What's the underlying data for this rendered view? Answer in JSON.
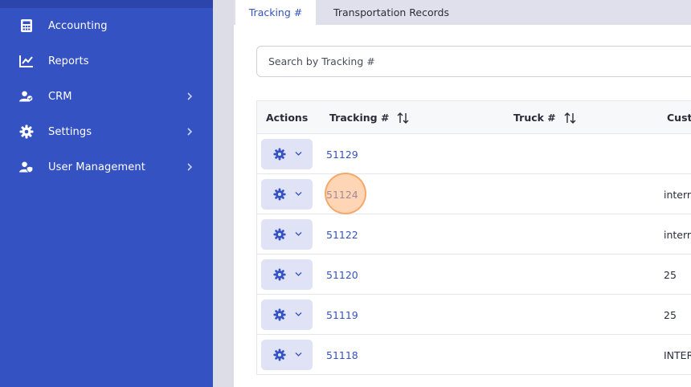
{
  "sidebar": {
    "items": [
      {
        "label": "Accounting",
        "icon": "calculator-icon",
        "has_children": false
      },
      {
        "label": "Reports",
        "icon": "line-chart-icon",
        "has_children": false
      },
      {
        "label": "CRM",
        "icon": "user-group-icon",
        "has_children": true
      },
      {
        "label": "Settings",
        "icon": "gear-icon",
        "has_children": true
      },
      {
        "label": "User Management",
        "icon": "user-shield-icon",
        "has_children": true
      }
    ]
  },
  "tabs": [
    {
      "label": "Tracking #",
      "active": true
    },
    {
      "label": "Transportation Records",
      "active": false
    }
  ],
  "search": {
    "placeholder": "Search by Tracking #",
    "value": ""
  },
  "table": {
    "columns": [
      "Actions",
      "Tracking #",
      "Truck #",
      "Custo"
    ],
    "rows": [
      {
        "tracking": "51129",
        "truck": "",
        "customer": ""
      },
      {
        "tracking": "51124",
        "truck": "",
        "customer": "interr"
      },
      {
        "tracking": "51122",
        "truck": "",
        "customer": "interr"
      },
      {
        "tracking": "51120",
        "truck": "",
        "customer": "25"
      },
      {
        "tracking": "51119",
        "truck": "",
        "customer": "25"
      },
      {
        "tracking": "51118",
        "truck": "",
        "customer": "INTER"
      }
    ]
  },
  "colors": {
    "sidebar_bg": "#3452c2",
    "accent": "#3452c2",
    "action_button_bg": "#dfe3f5",
    "click_indicator": "#f5a05a"
  }
}
